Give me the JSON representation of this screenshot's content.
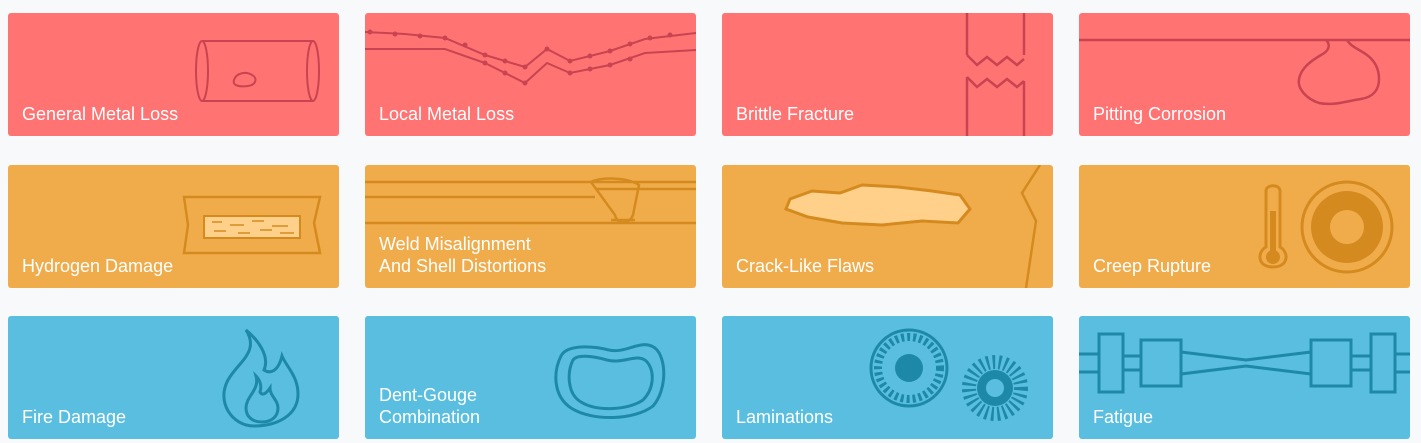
{
  "colors": {
    "red": "#ff7373",
    "orange": "#f0ac4b",
    "blue": "#59bedf",
    "red_stroke": "#c94450",
    "orange_stroke": "#d48a1f",
    "blue_stroke": "#1e88a8",
    "page_background": "#f8f9fb"
  },
  "cards": [
    {
      "row": 1,
      "label": [
        "General Metal Loss"
      ],
      "icon": "pipe-corrosion-icon"
    },
    {
      "row": 1,
      "label": [
        "Local Metal Loss"
      ],
      "icon": "thinning-profile-icon"
    },
    {
      "row": 1,
      "label": [
        "Brittle Fracture"
      ],
      "icon": "fracture-icon"
    },
    {
      "row": 1,
      "label": [
        "Pitting Corrosion"
      ],
      "icon": "pit-icon"
    },
    {
      "row": 2,
      "label": [
        "Hydrogen Damage"
      ],
      "icon": "hydrogen-blister-icon"
    },
    {
      "row": 2,
      "label": [
        "Weld Misalignment",
        "And Shell Distortions"
      ],
      "icon": "weld-icon"
    },
    {
      "row": 2,
      "label": [
        "Crack-Like Flaws"
      ],
      "icon": "crack-icon"
    },
    {
      "row": 2,
      "label": [
        "Creep Rupture"
      ],
      "icon": "thermometer-icon"
    },
    {
      "row": 3,
      "label": [
        "Fire Damage"
      ],
      "icon": "flame-icon"
    },
    {
      "row": 3,
      "label": [
        "Dent-Gouge",
        "Combination"
      ],
      "icon": "dent-icon"
    },
    {
      "row": 3,
      "label": [
        "Laminations"
      ],
      "icon": "gear-icon"
    },
    {
      "row": 3,
      "label": [
        "Fatigue"
      ],
      "icon": "shaft-icon"
    }
  ]
}
